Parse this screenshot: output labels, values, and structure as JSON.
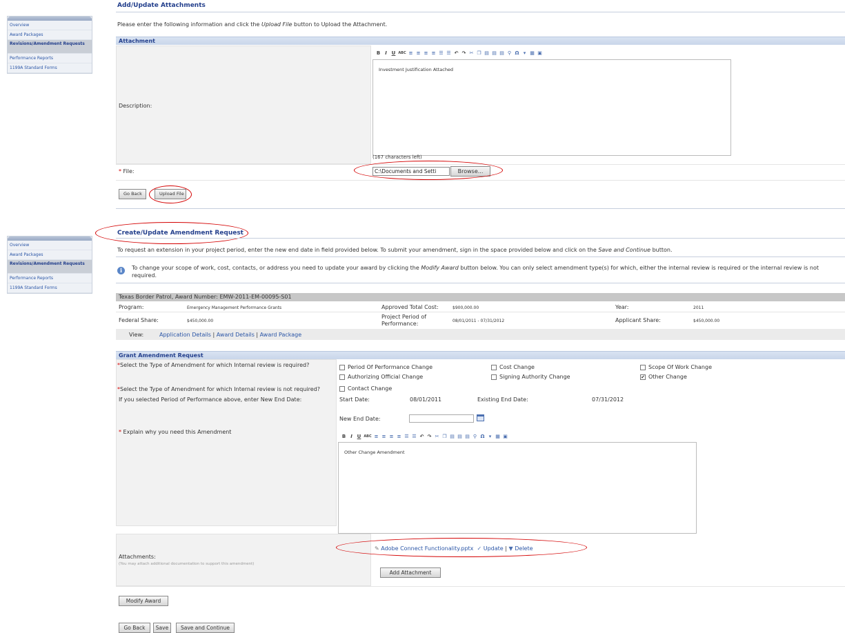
{
  "sidebar": {
    "items": [
      "Overview",
      "Award Packages",
      "Revisions/Amendment Requests",
      "Performance Reports",
      "1199A Standard Forms"
    ]
  },
  "attachments_pane": {
    "title": "Add/Update Attachments",
    "instruction_pre": "Please enter the following information and click the ",
    "instruction_em": "Upload File",
    "instruction_post": " button to Upload the Attachment.",
    "section": "Attachment",
    "description_label": "Description:",
    "description_text": "Investment Justification Attached",
    "chars_left": "(167 characters left)",
    "file_label": "File:",
    "file_value": "C:\\Documents and Setti",
    "browse": "Browse...",
    "go_back": "Go Back",
    "upload": "Upload File"
  },
  "amendment_pane": {
    "title": "Create/Update Amendment Request",
    "instruction_pre": "To request an extension in your project period, enter the new end date in field provided below. To submit your amendment, sign in the space provided below and click on the ",
    "instruction_em": "Save and Continue",
    "instruction_post": " button.",
    "info_line1_pre": "To change your scope of work, cost, contacts, or address you need to update your award by clicking the ",
    "info_line1_em": "Modify Award",
    "info_line1_post": " button below. You can only select amendment type(s) for which, either the internal review is required or the internal review is not",
    "info_line2": "required."
  },
  "award": {
    "header": "Texas Border Patrol, Award Number: EMW-2011-EM-00095-S01",
    "program_label": "Program:",
    "program_value": "Emergency Management Performance Grants",
    "approved_label": "Approved Total Cost:",
    "approved_value": "$900,000.00",
    "year_label": "Year:",
    "year_value": "2011",
    "federal_label": "Federal Share:",
    "federal_value": "$450,000.00",
    "period_label": "Project Period of Performance:",
    "period_value": "08/01/2011 - 07/31/2012",
    "applicant_label": "Applicant Share:",
    "applicant_value": "$450,000.00",
    "view_label": "View:",
    "view_links": [
      "Application Details",
      "Award Details",
      "Award Package"
    ]
  },
  "grant": {
    "section": "Grant Amendment Request",
    "q_required": "Select the Type of Amendment for which Internal review is required?",
    "q_not_required": "Select the Type of Amendment for which Internal review is not required?",
    "q_end_date": "If you selected Period of Performance above, enter New End Date:",
    "options": {
      "period": "Period Of Performance Change",
      "cost": "Cost Change",
      "scope": "Scope Of Work Change",
      "authorizing": "Authorizing Official Change",
      "signing": "Signing Authority Change",
      "other": "Other Change",
      "contact": "Contact Change"
    },
    "start_label": "Start Date:",
    "start_value": "08/01/2011",
    "existing_label": "Existing End Date:",
    "existing_value": "07/31/2012",
    "new_end_label": "New End Date:",
    "explain_label": "Explain why you need this Amendment",
    "explain_text": "Other Change Amendment",
    "attachments_label": "Attachments:",
    "attachments_hint": "(You may attach additional documentation to support this amendment)",
    "attachment_file": "Adobe Connect Functionality.pptx",
    "update": "Update",
    "delete": "Delete",
    "add_attachment": "Add Attachment",
    "modify_award": "Modify Award",
    "go_back": "Go Back",
    "save": "Save",
    "save_continue": "Save and Continue"
  },
  "colors": {
    "accent": "#233f8c",
    "link": "#2a55a6",
    "annotation": "#d40000"
  }
}
